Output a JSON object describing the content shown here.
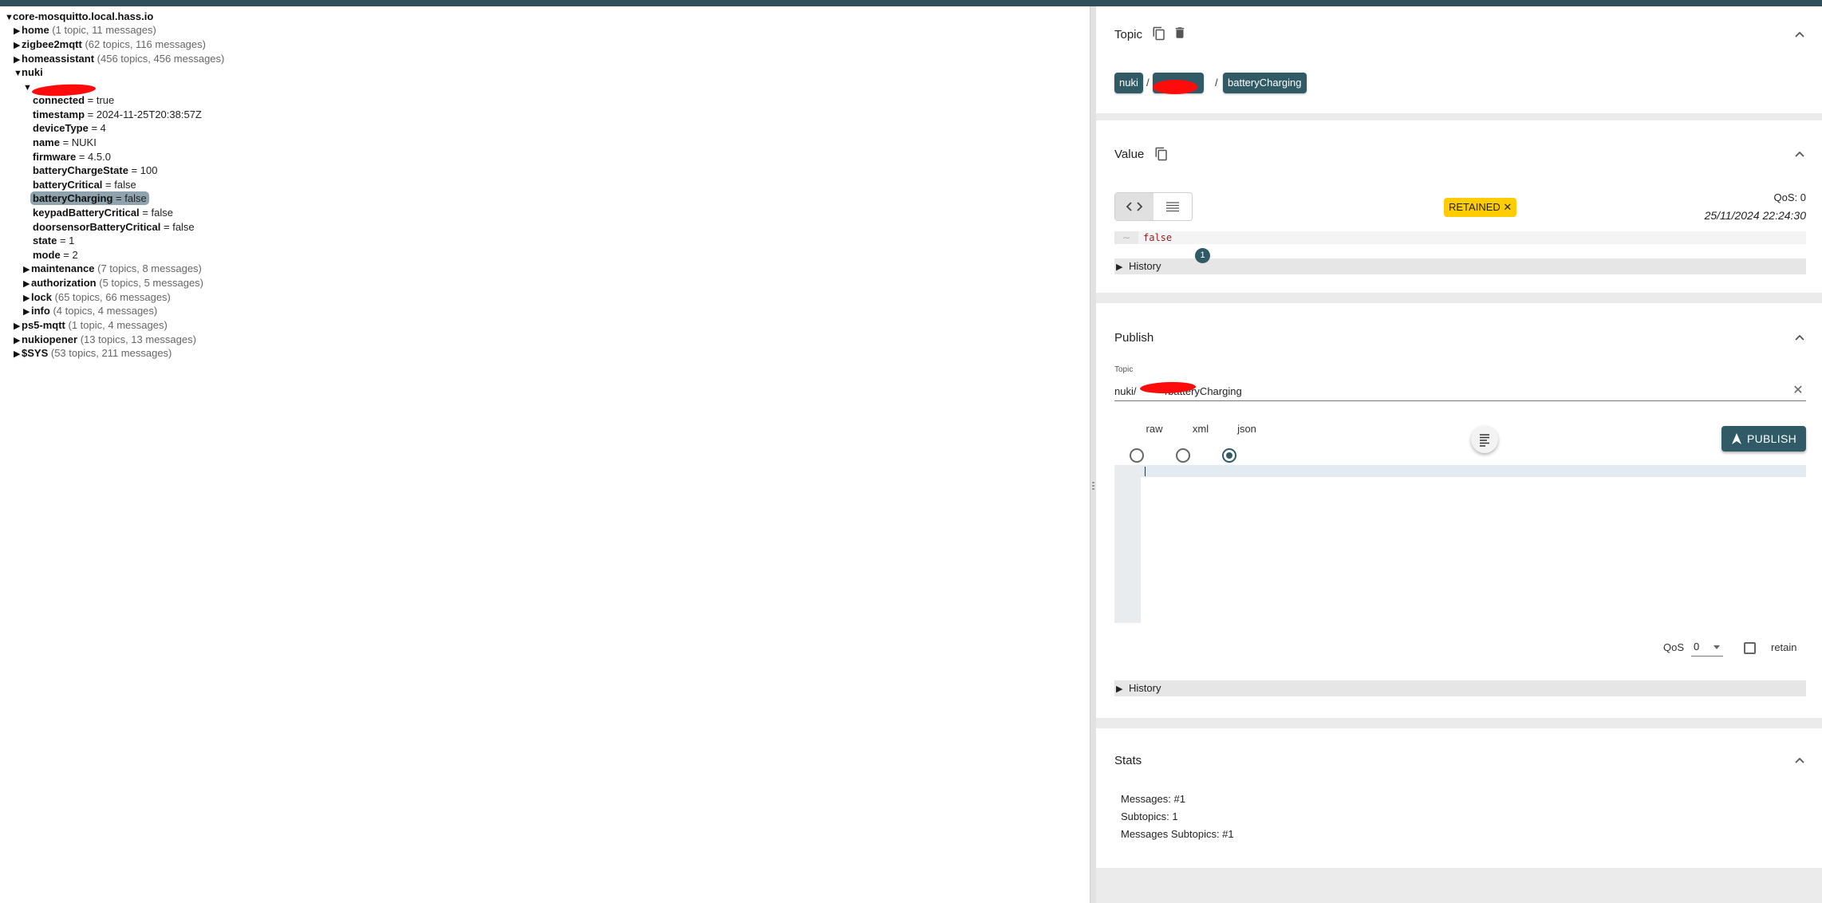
{
  "tree": {
    "root": {
      "name": "core-mosquitto.local.hass.io"
    },
    "top": [
      {
        "name": "home",
        "count": "(1 topic, 11 messages)"
      },
      {
        "name": "zigbee2mqtt",
        "count": "(62 topics, 116 messages)"
      },
      {
        "name": "homeassistant",
        "count": "(456 topics, 456 messages)"
      }
    ],
    "nuki": {
      "name": "nuki"
    },
    "device_values": [
      {
        "key": "connected",
        "value": " = true"
      },
      {
        "key": "timestamp",
        "value": " = 2024-11-25T20:38:57Z"
      },
      {
        "key": "deviceType",
        "value": " = 4"
      },
      {
        "key": "name",
        "value": " = NUKI"
      },
      {
        "key": "firmware",
        "value": " = 4.5.0"
      },
      {
        "key": "batteryChargeState",
        "value": " = 100"
      },
      {
        "key": "batteryCritical",
        "value": " = false"
      },
      {
        "key": "batteryCharging",
        "value": " = false"
      },
      {
        "key": "keypadBatteryCritical",
        "value": " = false"
      },
      {
        "key": "doorsensorBatteryCritical",
        "value": " = false"
      },
      {
        "key": "state",
        "value": " = 1"
      },
      {
        "key": "mode",
        "value": " = 2"
      }
    ],
    "device_subtopics": [
      {
        "name": "maintenance",
        "count": "(7 topics, 8 messages)"
      },
      {
        "name": "authorization",
        "count": "(5 topics, 5 messages)"
      },
      {
        "name": "lock",
        "count": "(65 topics, 66 messages)"
      },
      {
        "name": "info",
        "count": "(4 topics, 4 messages)"
      }
    ],
    "bottom": [
      {
        "name": "ps5-mqtt",
        "count": "(1 topic, 4 messages)"
      },
      {
        "name": "nukiopener",
        "count": "(13 topics, 13 messages)"
      },
      {
        "name": "$SYS",
        "count": "(53 topics, 211 messages)"
      }
    ]
  },
  "topic_panel": {
    "title": "Topic",
    "breadcrumb": [
      "nuki",
      "",
      "batteryCharging"
    ],
    "separator": "/"
  },
  "value_panel": {
    "title": "Value",
    "retained": "RETAINED",
    "retained_close": "✕",
    "qos": "QoS: 0",
    "timestamp": "25/11/2024 22:24:30",
    "value": "false",
    "history_label": "History",
    "history_count": "1"
  },
  "publish_panel": {
    "title": "Publish",
    "topic_label": "Topic",
    "topic_value": "nuki/          /batteryCharging",
    "clear": "✕",
    "formats": [
      "raw",
      "xml",
      "json"
    ],
    "selected_format": "json",
    "publish_label": "PUBLISH",
    "qos_label": "QoS",
    "qos_value": "0",
    "retain_label": "retain",
    "history_label": "History"
  },
  "stats_panel": {
    "title": "Stats",
    "lines": [
      "Messages: #1",
      "Subtopics: 1",
      "Messages Subtopics: #1"
    ]
  },
  "colors": {
    "accent": "#2f5a66",
    "retained": "#ffcc00",
    "topbar": "#2f4f5a"
  }
}
